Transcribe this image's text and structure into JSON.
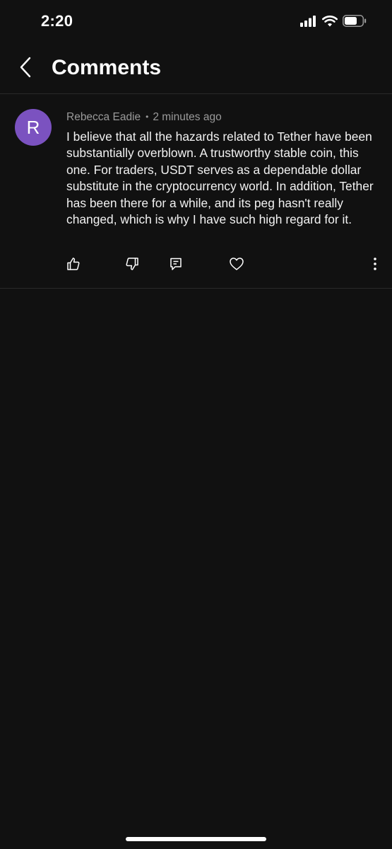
{
  "status_bar": {
    "time": "2:20",
    "icons": [
      "signal-icon",
      "wifi-icon",
      "battery-icon"
    ]
  },
  "header": {
    "title": "Comments",
    "back_icon": "chevron-left-icon"
  },
  "comment": {
    "avatar_letter": "R",
    "avatar_color": "#7b52c0",
    "author": "Rebecca Eadie",
    "separator": "•",
    "timestamp": "2 minutes ago",
    "body": "I believe that all the hazards related to Tether have been substantially overblown. A trustworthy stable coin, this one. For traders, USDT serves as a dependable dollar substitute in the cryptocurrency world. In addition, Tether has been there for a while, and its peg hasn't really changed, which is why I have such high regard for it.",
    "actions": [
      "thumbs-up-icon",
      "thumbs-down-icon",
      "reply-icon",
      "heart-icon",
      "more-vertical-icon"
    ]
  },
  "colors": {
    "background": "#111111",
    "divider": "#2a2a2a",
    "meta_text": "#9a9a9a"
  }
}
